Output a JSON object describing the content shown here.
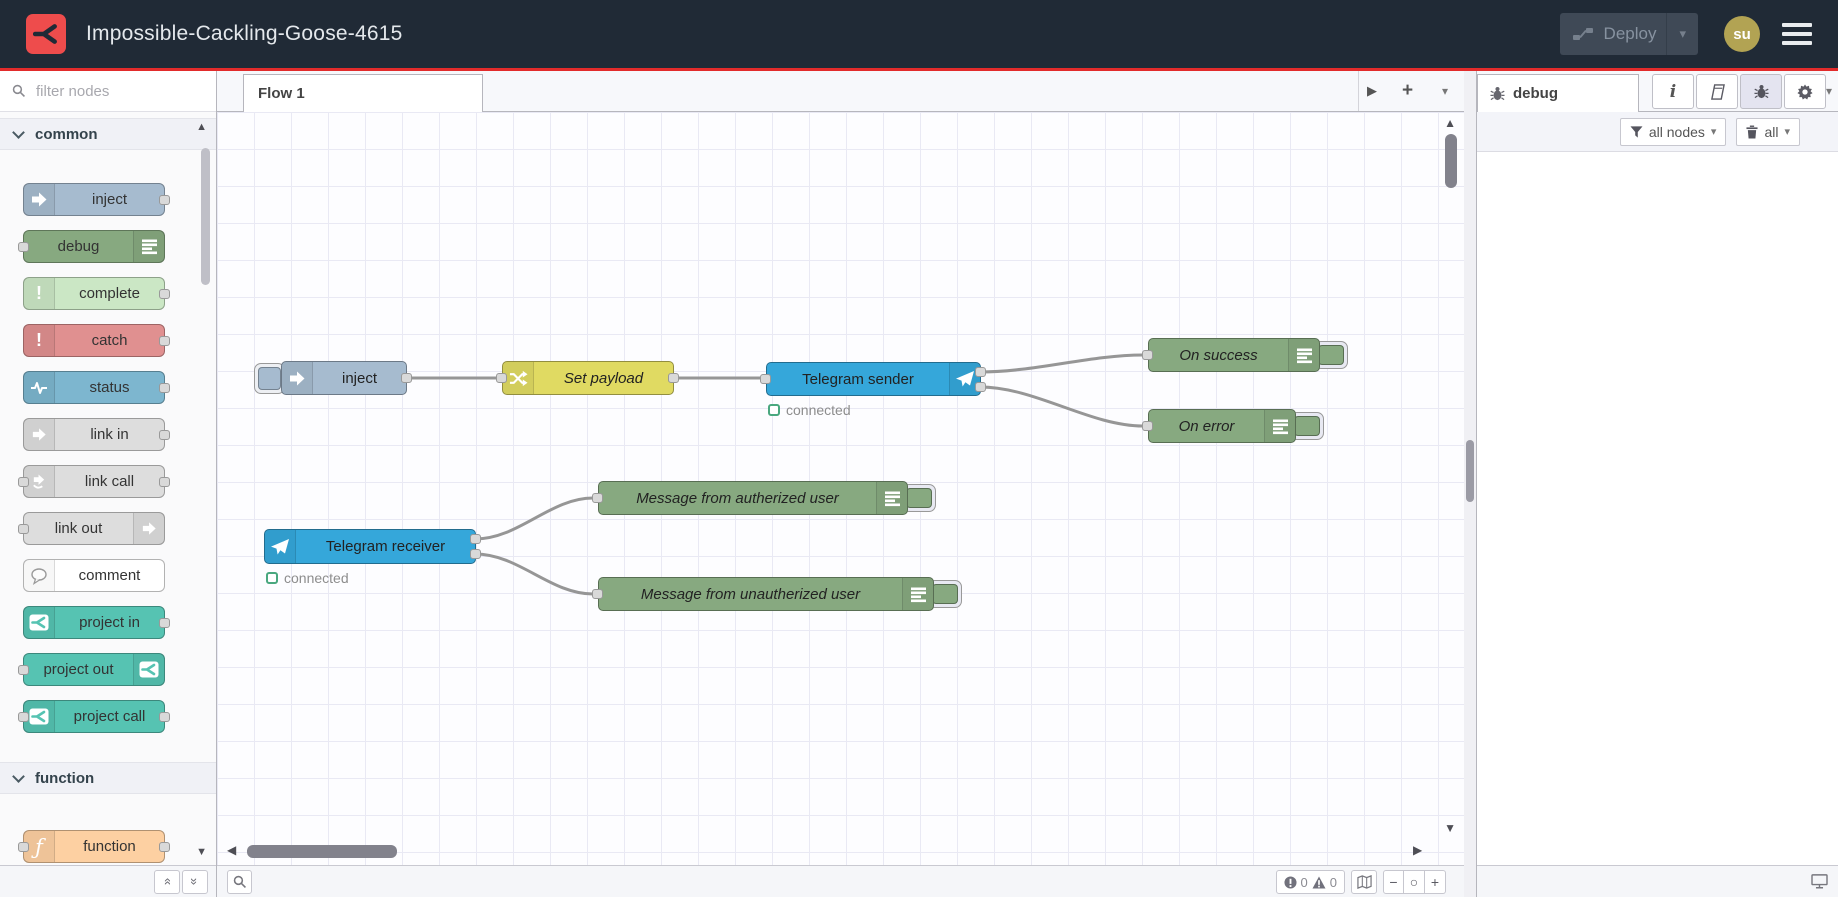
{
  "header": {
    "title": "Impossible-Cackling-Goose-4615",
    "deploy_label": "Deploy",
    "avatar_initials": "su"
  },
  "colors": {
    "header_bg": "#202a36",
    "accent_red": "#e22b2b",
    "logo_red": "#ee4c4c",
    "telegram_blue": "#35a7da",
    "debug_green": "#87a980",
    "change_yellow": "#e0da62",
    "inject_blue": "#a6bbcf",
    "complete_green": "#cbe7c5",
    "catch_red": "#e09090",
    "status_blue": "#7db6cf",
    "link_gray": "#dddddd",
    "project_teal": "#56c3b2",
    "function_orange": "#fdd0a2",
    "wire_gray": "#969696",
    "status_ok_green": "#4aa87f"
  },
  "palette": {
    "filter_placeholder": "filter nodes",
    "categories": [
      {
        "label": "common",
        "items": [
          {
            "label": "inject",
            "color": "#a6bbcf",
            "icon": "inject-arrow-icon"
          },
          {
            "label": "debug",
            "color": "#87a980",
            "icon": "debug-list-icon"
          },
          {
            "label": "complete",
            "color": "#cbe7c5",
            "icon": "exclamation-icon"
          },
          {
            "label": "catch",
            "color": "#e09090",
            "icon": "exclamation-icon"
          },
          {
            "label": "status",
            "color": "#7db6cf",
            "icon": "status-pulse-icon"
          },
          {
            "label": "link in",
            "color": "#dddddd",
            "icon": "link-arrow-icon"
          },
          {
            "label": "link call",
            "color": "#dddddd",
            "icon": "link-call-icon"
          },
          {
            "label": "link out",
            "color": "#dddddd",
            "icon": "link-arrow-icon"
          },
          {
            "label": "comment",
            "color": "#ffffff",
            "icon": "comment-bubble-icon"
          },
          {
            "label": "project in",
            "color": "#56c3b2",
            "icon": "project-logo-icon"
          },
          {
            "label": "project out",
            "color": "#56c3b2",
            "icon": "project-logo-icon"
          },
          {
            "label": "project call",
            "color": "#56c3b2",
            "icon": "project-logo-icon"
          }
        ]
      },
      {
        "label": "function",
        "items": [
          {
            "label": "function",
            "color": "#fdd0a2",
            "icon": "function-f-icon"
          }
        ]
      }
    ]
  },
  "workspace": {
    "tab_label": "Flow 1"
  },
  "flow": {
    "inject": {
      "label": "inject",
      "icon": "inject-arrow-icon"
    },
    "set_payload": {
      "label": "Set payload",
      "icon": "change-shuffle-icon"
    },
    "telegram_sender": {
      "label": "Telegram sender",
      "status": "connected",
      "icon": "telegram-plane-icon"
    },
    "on_success": {
      "label": "On success",
      "icon": "debug-list-icon"
    },
    "on_error": {
      "label": "On error",
      "icon": "debug-list-icon"
    },
    "telegram_receiver": {
      "label": "Telegram receiver",
      "status": "connected",
      "icon": "telegram-plane-icon"
    },
    "msg_authorized": {
      "label": "Message from autherized user",
      "icon": "debug-list-icon"
    },
    "msg_unauthorized": {
      "label": "Message from unautherized user",
      "icon": "debug-list-icon"
    }
  },
  "sidebar": {
    "tab_label": "debug",
    "filter_button": "all nodes",
    "clear_button": "all"
  },
  "status_bar": {
    "errors": "0",
    "warnings": "0"
  }
}
